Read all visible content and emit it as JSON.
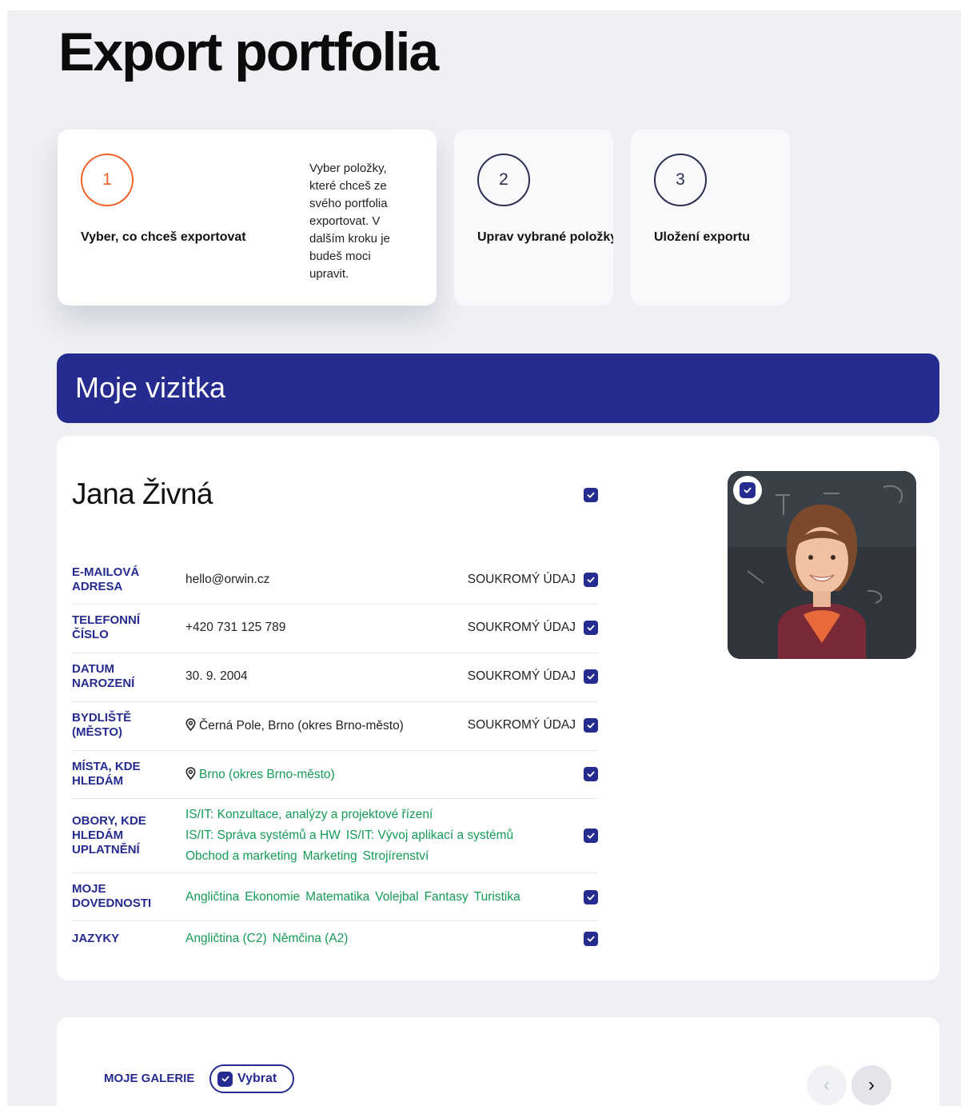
{
  "page": {
    "title": "Export portfolia"
  },
  "steps": [
    {
      "number": "1",
      "title": "Vyber, co chceš exportovat",
      "description": "Vyber položky, které chceš ze svého portfolia exportovat. V dalším kroku je budeš moci upravit."
    },
    {
      "number": "2",
      "title": "Uprav vybrané položky"
    },
    {
      "number": "3",
      "title": "Uložení exportu"
    }
  ],
  "section": {
    "title": "Moje vizitka"
  },
  "profile": {
    "name": "Jana Živná",
    "private_label": "SOUKROMÝ ÚDAJ",
    "rows": [
      {
        "label": "E-MAILOVÁ ADRESA",
        "value": "hello@orwin.cz"
      },
      {
        "label": "TELEFONNÍ ČÍSLO",
        "value": "+420 731 125 789"
      },
      {
        "label": "DATUM NAROZENÍ",
        "value": "30. 9. 2004"
      },
      {
        "label": "BYDLIŠTĚ (MĚSTO)",
        "value": "Černá Pole, Brno (okres Brno-město)"
      },
      {
        "label": "MÍSTA, KDE HLEDÁM",
        "value": "Brno (okres Brno-město)"
      },
      {
        "label": "OBORY, KDE HLEDÁM UPLATNĚNÍ",
        "tags": [
          "IS/IT: Konzultace, analýzy a projektové řízení",
          "IS/IT: Správa systémů a HW",
          "IS/IT: Vývoj aplikací a systémů",
          "Obchod a marketing",
          "Marketing",
          "Strojírenství"
        ]
      },
      {
        "label": "MOJE DOVEDNOSTI",
        "tags": [
          "Angličtina",
          "Ekonomie",
          "Matematika",
          "Volejbal",
          "Fantasy",
          "Turistika"
        ]
      },
      {
        "label": "JAZYKY",
        "tags": [
          "Angličtina (C2)",
          "Němčina (A2)"
        ]
      }
    ]
  },
  "gallery": {
    "label": "MOJE GALERIE",
    "select_label": "Vybrat"
  },
  "colors": {
    "brand": "#262c8f",
    "accent": "#f0632a",
    "tag": "#159a56",
    "background": "#eff0f4"
  },
  "icons": {
    "check": "check-icon",
    "pin": "map-pin-icon",
    "prev": "chevron-left-icon",
    "next": "chevron-right-icon"
  }
}
